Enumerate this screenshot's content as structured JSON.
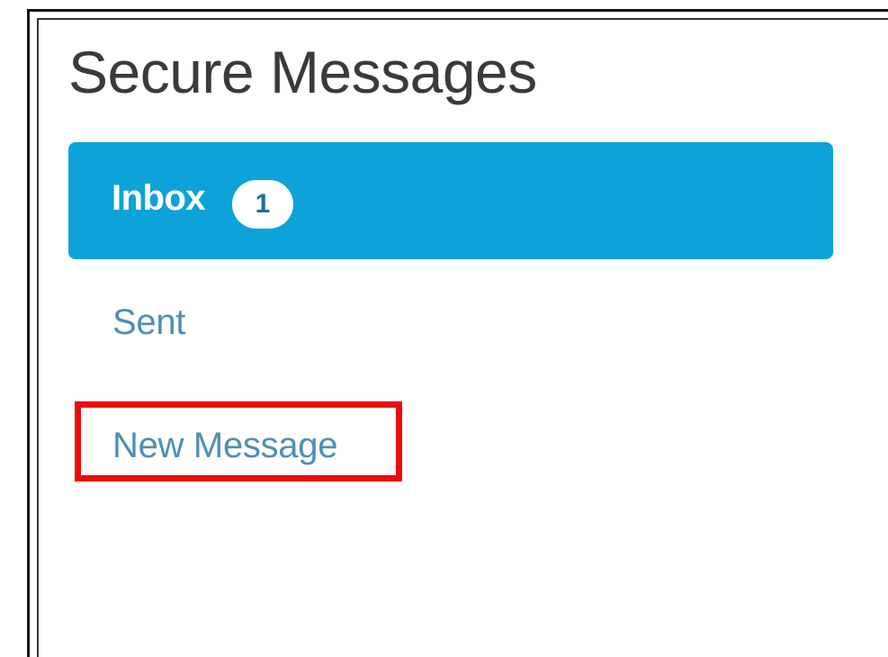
{
  "page": {
    "title": "Secure Messages"
  },
  "nav": {
    "inbox": {
      "label": "Inbox",
      "unread_count": "1",
      "active": true
    },
    "sent": {
      "label": "Sent"
    },
    "new_message": {
      "label": "New Message",
      "highlighted": true
    }
  },
  "colors": {
    "active_bg": "#0ea3d8",
    "link_text": "#4f8fb5",
    "highlight_border": "#ee0a0a",
    "title_text": "#3a3a3a"
  }
}
